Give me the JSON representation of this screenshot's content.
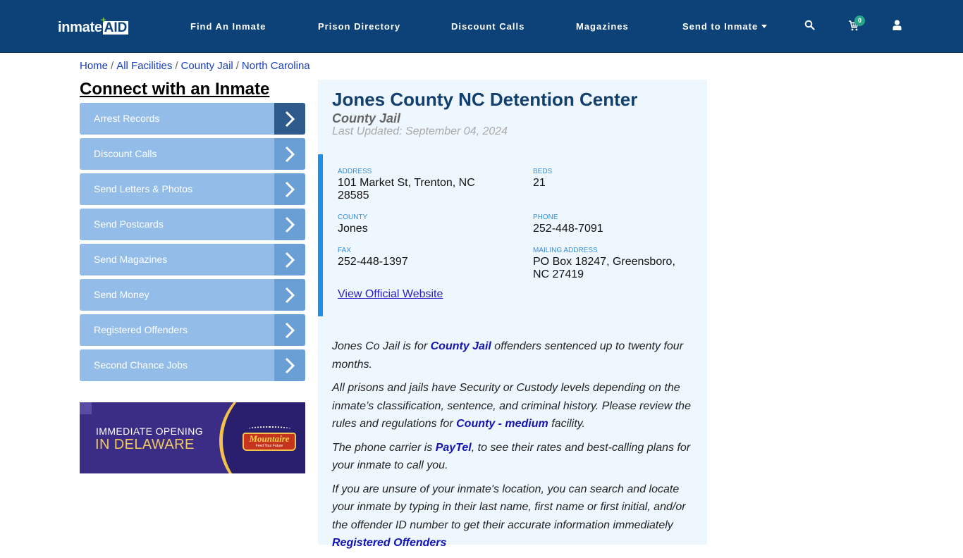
{
  "header": {
    "logo": {
      "text_main": "inmate",
      "text_accent": "AID",
      "plus": "+"
    },
    "nav": [
      {
        "label": "Find An Inmate"
      },
      {
        "label": "Prison Directory"
      },
      {
        "label": "Discount Calls"
      },
      {
        "label": "Magazines"
      },
      {
        "label": "Send to Inmate",
        "has_dropdown": true
      }
    ],
    "icons": {
      "search": "search-icon",
      "cart": "cart-icon",
      "user": "user-icon"
    },
    "cart_count": "0"
  },
  "breadcrumb": [
    {
      "label": "Home"
    },
    {
      "label": "All Facilities"
    },
    {
      "label": "County Jail"
    },
    {
      "label": "North Carolina"
    }
  ],
  "breadcrumb_separator": "/",
  "sidebar": {
    "title": "Connect with an Inmate",
    "items": [
      {
        "label": "Arrest Records",
        "active": true
      },
      {
        "label": "Discount Calls"
      },
      {
        "label": "Send Letters & Photos"
      },
      {
        "label": "Send Postcards"
      },
      {
        "label": "Send Magazines"
      },
      {
        "label": "Send Money"
      },
      {
        "label": "Registered Offenders"
      },
      {
        "label": "Second Chance Jobs"
      }
    ],
    "ad": {
      "line1": "IMMEDIATE OPENING",
      "line2": "IN DELAWARE",
      "brand": "Mountaire",
      "tagline": "Feed Your Future"
    }
  },
  "facility": {
    "name": "Jones County NC Detention Center",
    "type": "County Jail",
    "last_updated": "Last Updated: September 04, 2024",
    "fields": {
      "address": {
        "label": "ADDRESS",
        "value_line1": "101 Market St, Trenton, NC",
        "value_line2": "28585"
      },
      "beds": {
        "label": "BEDS",
        "value": "21"
      },
      "county": {
        "label": "COUNTY",
        "value": "Jones"
      },
      "phone": {
        "label": "PHONE",
        "value": "252-448-7091"
      },
      "fax": {
        "label": "FAX",
        "value": "252-448-1397"
      },
      "mailing_address": {
        "label": "MAILING ADDRESS",
        "value_line1": "PO Box 18247, Greensboro,",
        "value_line2": "NC 27419"
      }
    },
    "official_link": "View Official Website"
  },
  "description": {
    "p1": {
      "before": "Jones Co Jail is for ",
      "link": "County Jail",
      "after": " offenders sentenced up to twenty four months."
    },
    "p2": {
      "before": "All prisons and jails have Security or Custody levels depending on the inmate’s classification, sentence, and criminal history. Please review the rules and regulations for ",
      "link": "County - medium",
      "after": " facility."
    },
    "p3": {
      "before": "The phone carrier is ",
      "link": "PayTel",
      "after": ", to see their rates and best-calling plans for your inmate to call you."
    },
    "p4": {
      "before": "If you are unsure of your inmate's location, you can search and locate your inmate by typing in their last name, first name or first initial, and/or the offender ID number to get their accurate information immediately ",
      "link": "Registered Offenders"
    }
  },
  "colors": {
    "navbar": "#0c4278",
    "menu_item": "#93bde8",
    "menu_arrow": "#6a9fd6",
    "menu_arrow_active": "#2f5b8c",
    "panel_bg": "#eef7fd",
    "accent_bar": "#1e90e8",
    "title": "#123f6e",
    "link": "#1212b5",
    "cart_badge": "#26a58b"
  }
}
